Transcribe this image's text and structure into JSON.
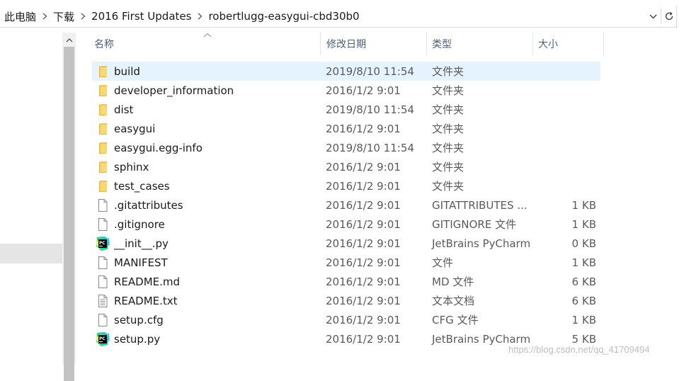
{
  "address_bar": {
    "breadcrumbs": [
      "此电脑",
      "下载",
      "2016 First Updates",
      "robertlugg-easygui-cbd30b0"
    ]
  },
  "columns": {
    "name": "名称",
    "date": "修改日期",
    "type": "类型",
    "size": "大小"
  },
  "files": [
    {
      "name": "build",
      "date": "2019/8/10 11:54",
      "type": "文件夹",
      "size": "",
      "icon": "folder-icon",
      "selected": true
    },
    {
      "name": "developer_information",
      "date": "2016/1/2 9:01",
      "type": "文件夹",
      "size": "",
      "icon": "folder-icon"
    },
    {
      "name": "dist",
      "date": "2019/8/10 11:54",
      "type": "文件夹",
      "size": "",
      "icon": "folder-icon"
    },
    {
      "name": "easygui",
      "date": "2016/1/2 9:01",
      "type": "文件夹",
      "size": "",
      "icon": "folder-icon"
    },
    {
      "name": "easygui.egg-info",
      "date": "2019/8/10 11:54",
      "type": "文件夹",
      "size": "",
      "icon": "folder-icon"
    },
    {
      "name": "sphinx",
      "date": "2016/1/2 9:01",
      "type": "文件夹",
      "size": "",
      "icon": "folder-icon"
    },
    {
      "name": "test_cases",
      "date": "2016/1/2 9:01",
      "type": "文件夹",
      "size": "",
      "icon": "folder-icon"
    },
    {
      "name": ".gitattributes",
      "date": "2016/1/2 9:01",
      "type": "GITATTRIBUTES ...",
      "size": "1 KB",
      "icon": "file-icon"
    },
    {
      "name": ".gitignore",
      "date": "2016/1/2 9:01",
      "type": "GITIGNORE 文件",
      "size": "1 KB",
      "icon": "file-icon"
    },
    {
      "name": "__init__.py",
      "date": "2016/1/2 9:01",
      "type": "JetBrains PyCharm",
      "size": "0 KB",
      "icon": "pycharm-icon"
    },
    {
      "name": "MANIFEST",
      "date": "2016/1/2 9:01",
      "type": "文件",
      "size": "1 KB",
      "icon": "file-icon"
    },
    {
      "name": "README.md",
      "date": "2016/1/2 9:01",
      "type": "MD 文件",
      "size": "6 KB",
      "icon": "file-icon"
    },
    {
      "name": "README.txt",
      "date": "2016/1/2 9:01",
      "type": "文本文档",
      "size": "6 KB",
      "icon": "text-file-icon"
    },
    {
      "name": "setup.cfg",
      "date": "2016/1/2 9:01",
      "type": "CFG 文件",
      "size": "1 KB",
      "icon": "file-icon"
    },
    {
      "name": "setup.py",
      "date": "2016/1/2 9:01",
      "type": "JetBrains PyCharm",
      "size": "5 KB",
      "icon": "pycharm-icon"
    }
  ],
  "watermark": "https://blog.csdn.net/qq_41709494",
  "colors": {
    "selection": "#e5f3ff",
    "folder": "#f8d775",
    "header_text": "#4c607a",
    "pycharm_green": "#21d789"
  }
}
